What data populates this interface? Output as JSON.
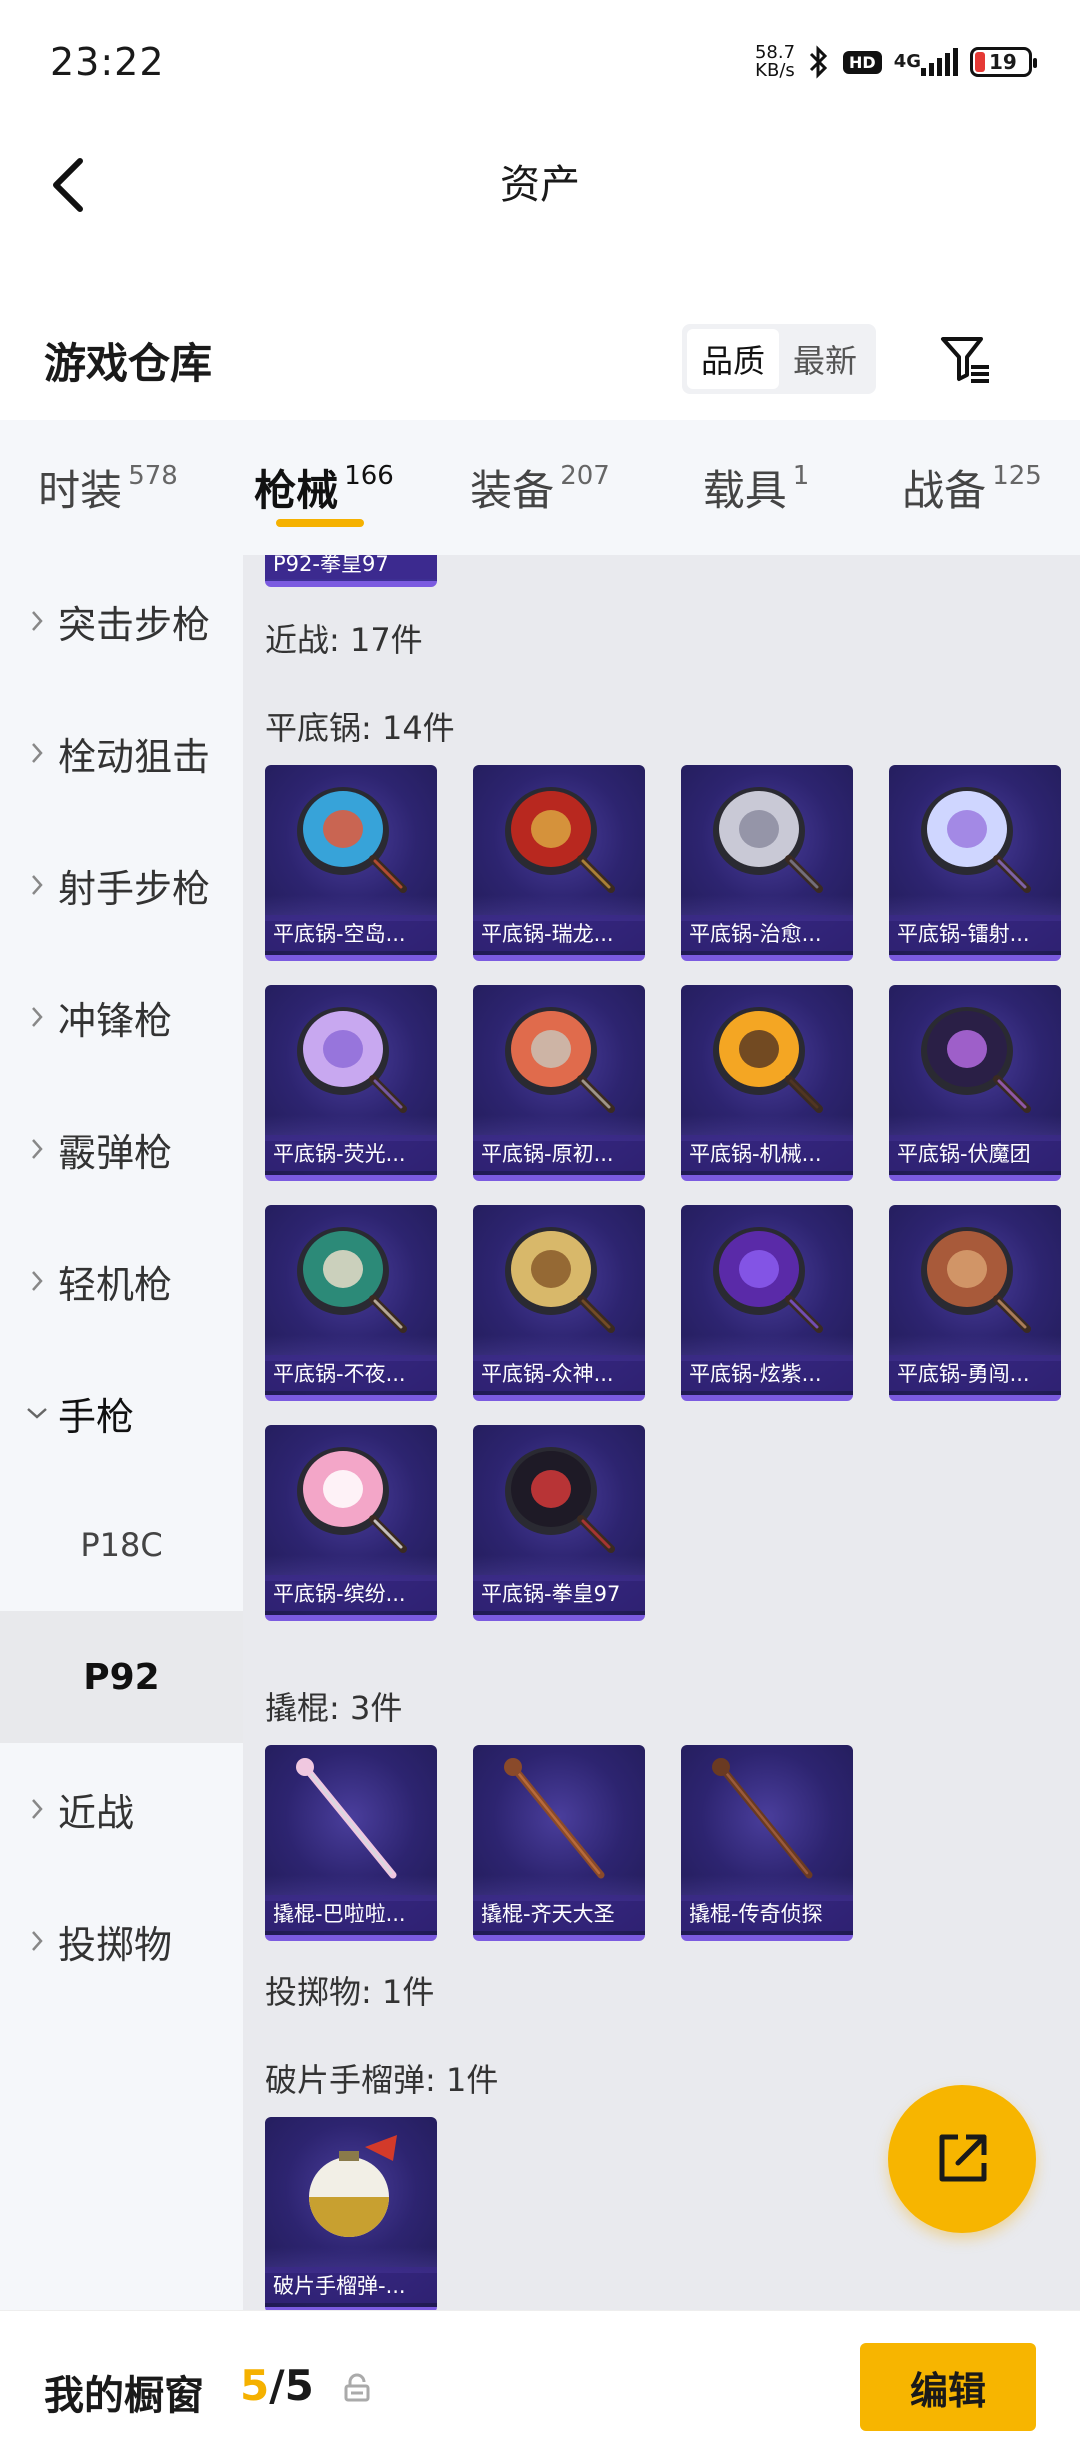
{
  "status_bar": {
    "time": "23:22",
    "net_speed_value": "58.7",
    "net_speed_unit": "KB/s",
    "hd": "HD",
    "network": "4G",
    "battery": "19"
  },
  "header": {
    "title": "资产"
  },
  "warehouse": {
    "title": "游戏仓库",
    "sort_options": [
      "品质",
      "最新"
    ],
    "active_sort": "品质"
  },
  "tabs": [
    {
      "label": "时装",
      "count": "578"
    },
    {
      "label": "枪械",
      "count": "166",
      "active": true
    },
    {
      "label": "装备",
      "count": "207"
    },
    {
      "label": "载具",
      "count": "1"
    },
    {
      "label": "战备",
      "count": "125"
    }
  ],
  "sidebar": {
    "items": [
      {
        "label": "突击步枪"
      },
      {
        "label": "栓动狙击"
      },
      {
        "label": "射手步枪"
      },
      {
        "label": "冲锋枪"
      },
      {
        "label": "霰弹枪"
      },
      {
        "label": "轻机枪"
      },
      {
        "label": "手枪"
      },
      {
        "label": "近战"
      },
      {
        "label": "投掷物"
      }
    ],
    "subitems": [
      {
        "label": "P18C"
      },
      {
        "label": "P92",
        "active": true
      }
    ]
  },
  "content": {
    "partial_card": "P92-拳皇97",
    "sections": {
      "melee": "近战: 17件",
      "pan": "平底锅: 14件",
      "crowbar": "撬棍: 3件",
      "throwable": "投掷物: 1件",
      "frag": "破片手榴弹: 1件"
    },
    "pans": [
      {
        "name": "平底锅-空岛...",
        "colors": [
          "#37a3d9",
          "#e35a3a"
        ]
      },
      {
        "name": "平底锅-瑞龙...",
        "colors": [
          "#b8281f",
          "#d9a441"
        ]
      },
      {
        "name": "平底锅-治愈...",
        "colors": [
          "#c9c9d6",
          "#8c8ca0"
        ]
      },
      {
        "name": "平底锅-镭射...",
        "colors": [
          "#cfd6ff",
          "#9b7be0"
        ]
      },
      {
        "name": "平底锅-荧光...",
        "colors": [
          "#c8a8f0",
          "#8e6cd8"
        ]
      },
      {
        "name": "平底锅-原初...",
        "colors": [
          "#e06b4c",
          "#c9c1b5"
        ]
      },
      {
        "name": "平底锅-机械...",
        "colors": [
          "#f4a623",
          "#5a3a22"
        ]
      },
      {
        "name": "平底锅-伏魔团",
        "colors": [
          "#2a1f46",
          "#b36be0"
        ]
      },
      {
        "name": "平底锅-不夜...",
        "colors": [
          "#2c8a78",
          "#e8dcc8"
        ]
      },
      {
        "name": "平底锅-众神...",
        "colors": [
          "#d8b86a",
          "#8a5a2a"
        ]
      },
      {
        "name": "平底锅-炫紫...",
        "colors": [
          "#5a2aa8",
          "#8b5cf0"
        ]
      },
      {
        "name": "平底锅-勇闯...",
        "colors": [
          "#a85a3a",
          "#d8a070"
        ]
      },
      {
        "name": "平底锅-缤纷...",
        "colors": [
          "#f3a6c8",
          "#ffffff"
        ]
      },
      {
        "name": "平底锅-拳皇97",
        "colors": [
          "#1e1a26",
          "#d33a3a"
        ]
      }
    ],
    "crowbars": [
      {
        "name": "撬棍-巴啦啦...",
        "colors": [
          "#f0c8e0",
          "#d8d8e0"
        ]
      },
      {
        "name": "撬棍-齐天大圣",
        "colors": [
          "#8a4a2a",
          "#b86a3a"
        ]
      },
      {
        "name": "撬棍-传奇侦探",
        "colors": [
          "#6a3a22",
          "#9a5a3a"
        ]
      }
    ],
    "frags": [
      {
        "name": "破片手榴弹-...",
        "colors": [
          "#f2efe6",
          "#c8a030"
        ]
      }
    ]
  },
  "bottom_bar": {
    "label": "我的橱窗",
    "count_current": "5",
    "count_sep_total": "/5",
    "edit_label": "编辑"
  },
  "colors": {
    "accent": "#f7b500",
    "card_bg": "#2d2470",
    "card_border": "#7b5be0"
  }
}
